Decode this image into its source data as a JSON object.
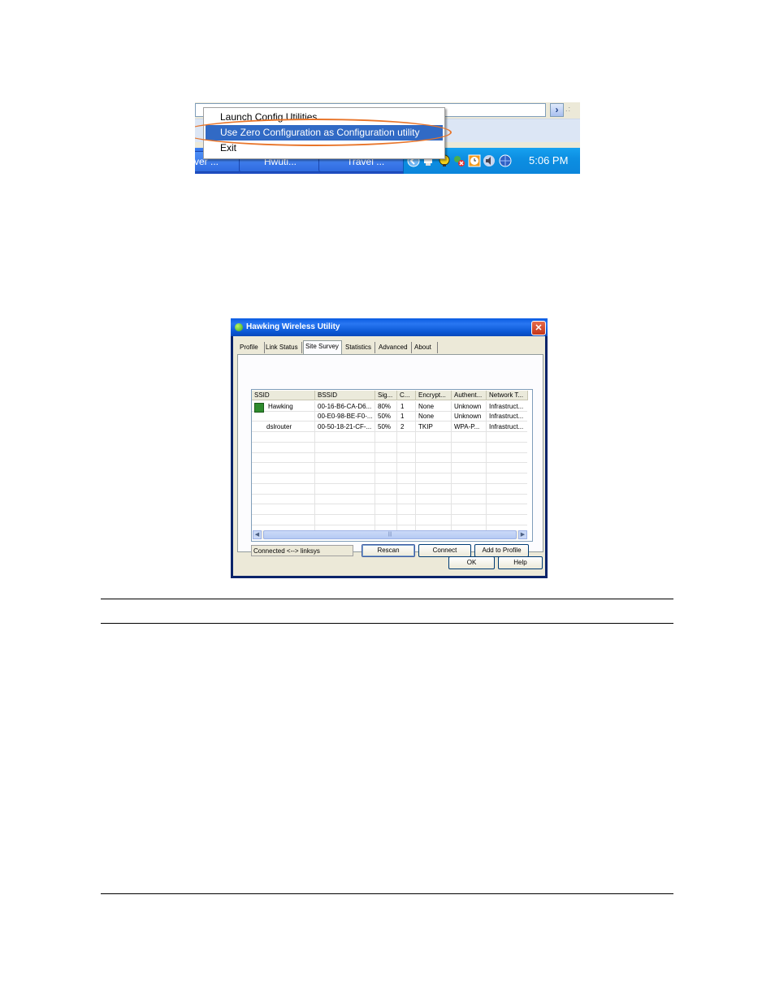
{
  "tray_menu": {
    "items": [
      "Launch Config Utilities",
      "Use Zero Configuration as Configuration utility",
      "Exit"
    ],
    "selected_index": 1,
    "taskbar_buttons": [
      "ver ...",
      "Hwuti...",
      "Travel ..."
    ],
    "clock": "5:06 PM",
    "highlight_color": "#E8752A"
  },
  "utility_window": {
    "title": "Hawking Wireless Utility",
    "tabs": [
      "Profile",
      "Link Status",
      "Site Survey",
      "Statistics",
      "Advanced",
      "About"
    ],
    "active_tab_index": 2,
    "columns": [
      "SSID",
      "BSSID",
      "Sig...",
      "C...",
      "Encrypt...",
      "Authent...",
      "Network T..."
    ],
    "rows": [
      [
        "Hawking",
        "00-16-B6-CA-D6...",
        "80%",
        "1",
        "None",
        "Unknown",
        "Infrastruct..."
      ],
      [
        "",
        "00-E0-98-BE-F0-...",
        "50%",
        "1",
        "None",
        "Unknown",
        "Infrastruct..."
      ],
      [
        "dslrouter",
        "00-50-18-21-CF-...",
        "50%",
        "2",
        "TKIP",
        "WPA-P...",
        "Infrastruct..."
      ]
    ],
    "status": "Connected <--> linksys",
    "buttons": {
      "rescan": "Rescan",
      "connect": "Connect",
      "add_profile": "Add to Profile"
    },
    "footer_buttons": {
      "ok": "OK",
      "help": "Help"
    }
  }
}
